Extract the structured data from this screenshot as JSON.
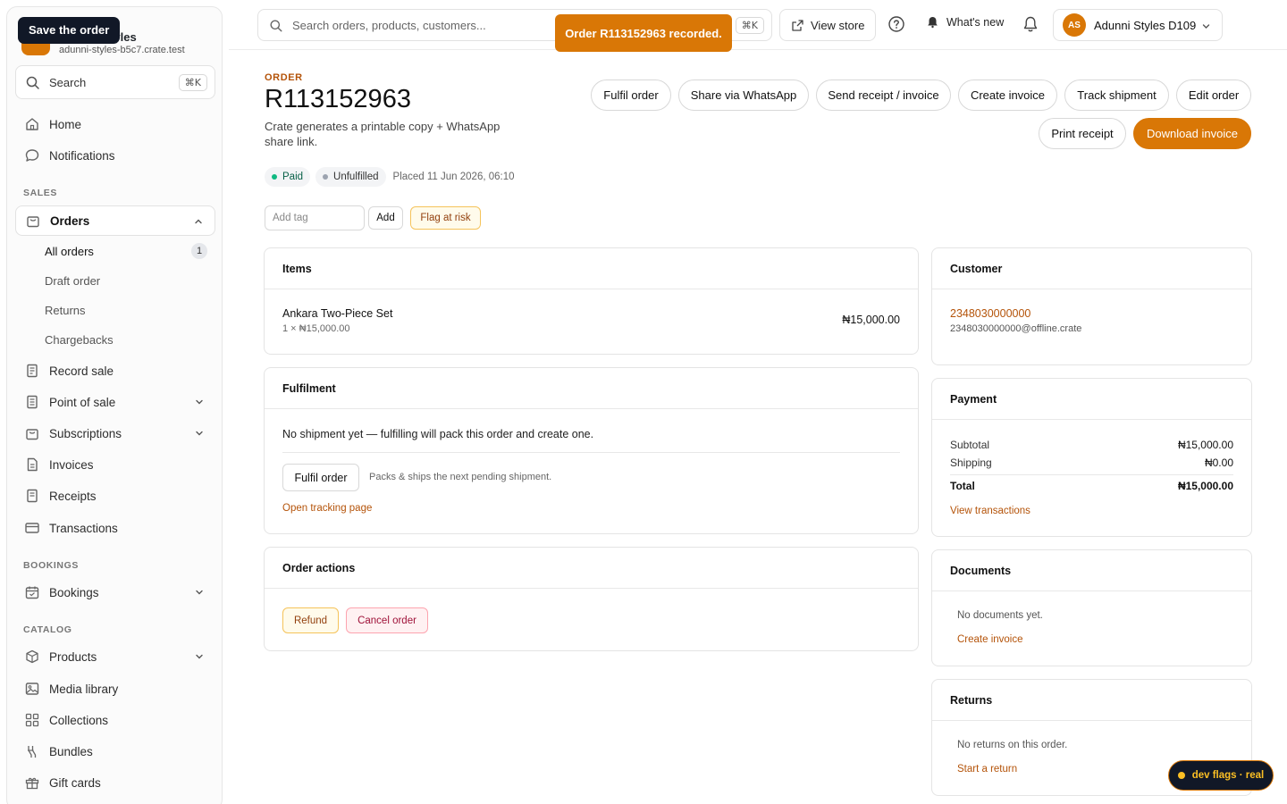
{
  "brand": {
    "tooltip": "Save the order",
    "name": "Adunni Styles",
    "host": "adunni-styles-b5c7.crate.test"
  },
  "sidebar": {
    "search_label": "Search",
    "search_kbd": "⌘K",
    "home": "Home",
    "notifications": "Notifications",
    "sales_label": "SALES",
    "orders": "Orders",
    "orders_sub": {
      "all_orders": "All orders",
      "all_orders_count": "1",
      "draft_order": "Draft order",
      "returns": "Returns",
      "chargebacks": "Chargebacks"
    },
    "record_sale": "Record sale",
    "point_of_sale": "Point of sale",
    "subscriptions": "Subscriptions",
    "invoices": "Invoices",
    "receipts": "Receipts",
    "transactions": "Transactions",
    "bookings_label": "BOOKINGS",
    "bookings": "Bookings",
    "catalog_label": "CATALOG",
    "products": "Products",
    "media_library": "Media library",
    "collections": "Collections",
    "bundles": "Bundles",
    "gift_cards": "Gift cards"
  },
  "topbar": {
    "search_placeholder": "Search orders, products, customers...",
    "search_kbd": "⌘K",
    "view_store": "View store",
    "whats_new": "What's new",
    "account_initials": "AS",
    "account_name": "Adunni Styles D109"
  },
  "toast": "Order R113152963 recorded.",
  "order": {
    "eyebrow": "ORDER",
    "number": "R113152963",
    "subtitle": "Crate generates a printable copy + WhatsApp share link.",
    "status_paid": "Paid",
    "status_fulfilment": "Unfulfilled",
    "placed": "Placed 11 Jun 2026, 06:10",
    "tag_placeholder": "Add tag",
    "tag_add": "Add",
    "flag_at_risk": "Flag at risk"
  },
  "actions": {
    "fulfil_order": "Fulfil order",
    "share_whatsapp": "Share via WhatsApp",
    "send_receipt": "Send receipt / invoice",
    "create_invoice": "Create invoice",
    "track_shipment": "Track shipment",
    "edit_order": "Edit order",
    "print_receipt": "Print receipt",
    "download_invoice": "Download invoice"
  },
  "items_card": {
    "title": "Items",
    "items": [
      {
        "name": "Ankara Two-Piece Set",
        "qty_line": "1 × ₦15,000.00",
        "total": "₦15,000.00"
      }
    ]
  },
  "fulfilment_card": {
    "title": "Fulfilment",
    "message": "No shipment yet — fulfilling will pack this order and create one.",
    "button": "Fulfil order",
    "hint": "Packs & ships the next pending shipment.",
    "tracking_link": "Open tracking page"
  },
  "order_actions_card": {
    "title": "Order actions",
    "refund": "Refund",
    "cancel": "Cancel order"
  },
  "customer_card": {
    "title": "Customer",
    "phone": "2348030000000",
    "email": "2348030000000@offline.crate"
  },
  "payment_card": {
    "title": "Payment",
    "subtotal_label": "Subtotal",
    "subtotal": "₦15,000.00",
    "shipping_label": "Shipping",
    "shipping": "₦0.00",
    "total_label": "Total",
    "total": "₦15,000.00",
    "link": "View transactions"
  },
  "documents_card": {
    "title": "Documents",
    "empty": "No documents yet.",
    "link": "Create invoice"
  },
  "returns_card": {
    "title": "Returns",
    "empty": "No returns on this order.",
    "link": "Start a return"
  },
  "dev_flags": "dev flags · real",
  "colors": {
    "accent": "#d97706",
    "accent_text": "#b45309",
    "paid": "#10b981"
  }
}
